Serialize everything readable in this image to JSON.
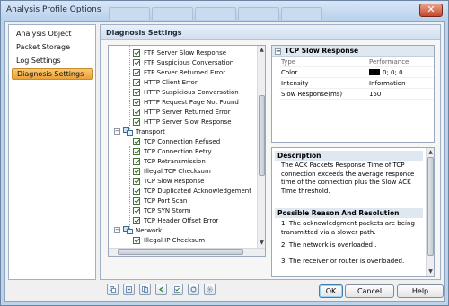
{
  "window": {
    "title": "Analysis Profile Options",
    "close_glyph": "✕"
  },
  "nav": {
    "items": [
      {
        "label": "Analysis Object",
        "selected": false
      },
      {
        "label": "Packet Storage",
        "selected": false
      },
      {
        "label": "Log Settings",
        "selected": false
      },
      {
        "label": "Diagnosis Settings",
        "selected": true
      }
    ]
  },
  "main": {
    "header": "Diagnosis Settings",
    "tree": {
      "app_items": [
        "FTP Server Slow Response",
        "FTP Suspicious Conversation",
        "FTP Server Returned Error",
        "HTTP Client Error",
        "HTTP Suspicious Conversation",
        "HTTP Request Page Not Found",
        "HTTP Server Returned Error",
        "HTTP Server Slow Response"
      ],
      "transport_label": "Transport",
      "transport_items": [
        "TCP Connection Refused",
        "TCP Connection Retry",
        "TCP Retransmission",
        "Illegal TCP Checksum",
        "TCP Slow Response",
        "TCP Duplicated Acknowledgement",
        "TCP Port Scan",
        "TCP SYN Storm",
        "TCP Header Offset Error"
      ],
      "network_label": "Network",
      "network_items": [
        "Illegal IP Checksum"
      ],
      "expander_minus": "−"
    },
    "properties": {
      "title": "TCP Slow Response",
      "collapse_glyph": "−",
      "rows": [
        {
          "key": "Type",
          "value": "Performance",
          "header": true
        },
        {
          "key": "Color",
          "value": "0; 0; 0",
          "swatch": "#000000"
        },
        {
          "key": "Intensity",
          "value": "Information"
        },
        {
          "key": "Slow Response(ms)",
          "value": "150"
        }
      ]
    },
    "description": {
      "title": "Description",
      "text": "The ACK Packets Response Time of TCP connection exceeds the average responce time of the connection plus the Slow ACK Time threshold.",
      "resolution_title": "Possible Reason And Resolution",
      "resolutions": [
        "1. The acknowledgment packets are being transmitted via a slower path.",
        "2. The network is overloaded .",
        "3. The receiver or router is overloaded."
      ]
    },
    "toolbar_icons": [
      "expand-all-icon",
      "collapse-all-icon",
      "copy-icon",
      "back-icon",
      "select-all-icon",
      "refresh-icon",
      "settings-icon"
    ]
  },
  "buttons": {
    "ok": "OK",
    "cancel": "Cancel",
    "help": "Help"
  },
  "colors": {
    "selection": "#eaa23b",
    "checkmark": "#1f6a1f",
    "header_bg": "#dfe7f1"
  }
}
